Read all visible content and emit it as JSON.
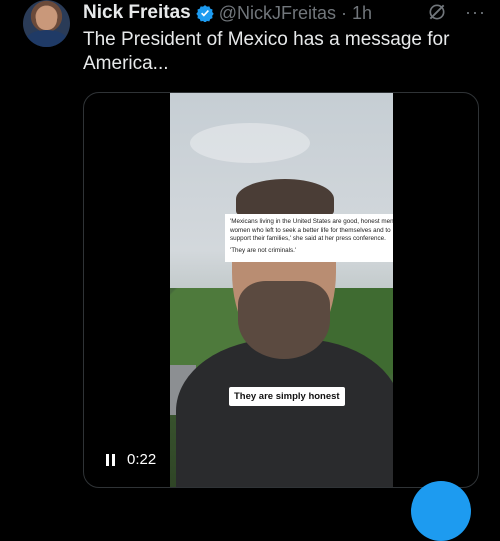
{
  "tweet": {
    "author_name": "Nick Freitas",
    "handle": "@NickJFreitas",
    "separator": "·",
    "timestamp": "1h",
    "text": "The President of Mexico has a message for America..."
  },
  "icons": {
    "verified": "verified-badge-icon",
    "grok": "grok-icon",
    "more": "more-icon",
    "pause": "pause-icon"
  },
  "more_glyph": "···",
  "video": {
    "quote_paragraph_1": "'Mexicans living in the United States are good, honest men and women who left to seek a better life for themselves and to support their families,' she said at her press conference.",
    "quote_paragraph_2": "'They are not criminals.'",
    "caption": "They are simply honest",
    "elapsed_time": "0:22"
  },
  "colors": {
    "accent": "#1d9bf0",
    "text_primary": "#e7e9ea",
    "text_secondary": "#71767b",
    "background": "#000000"
  }
}
